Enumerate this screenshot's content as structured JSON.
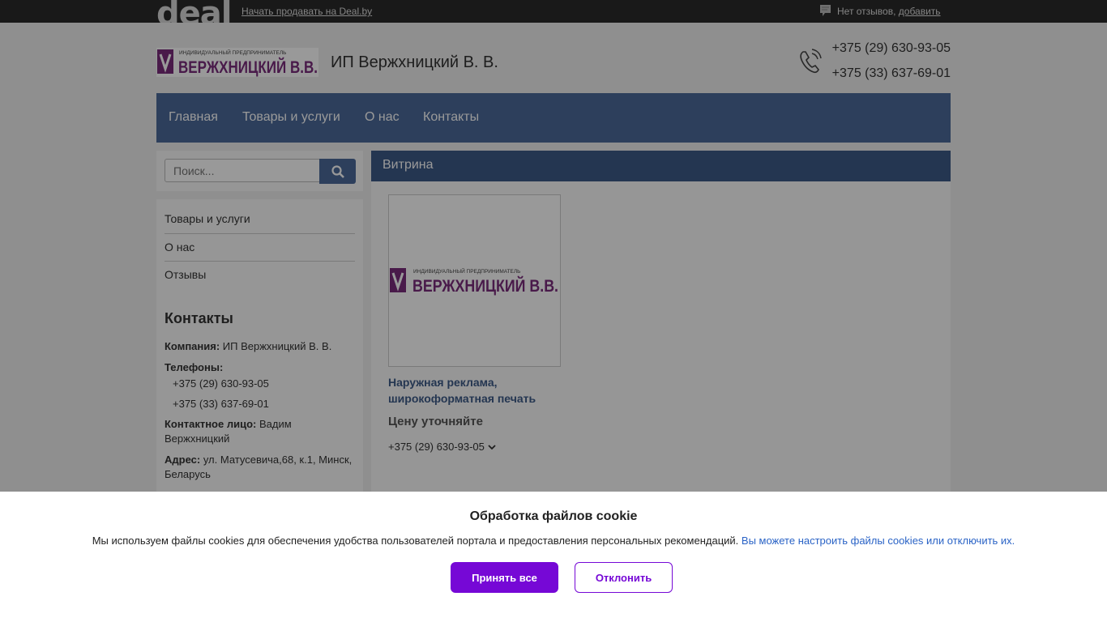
{
  "topbar": {
    "logo": "deal",
    "sell_link": "Начать продавать на Deal.by",
    "reviews_text": "Нет отзывов, ",
    "reviews_add": "добавить"
  },
  "header": {
    "logo_small_text": "ИНДИВИДУАЛЬНЫЙ ПРЕДПРИНИМАТЕЛЬ",
    "logo_big_text": "ВЕРЖХНИЦКИЙ В.В.",
    "company_name": "ИП Вержхницкий В. В.",
    "phones": [
      "+375 (29) 630-93-05",
      "+375 (33) 637-69-01"
    ]
  },
  "nav": {
    "items": [
      {
        "label": "Главная"
      },
      {
        "label": "Товары и услуги"
      },
      {
        "label": "О нас"
      },
      {
        "label": "Контакты"
      }
    ]
  },
  "search": {
    "placeholder": "Поиск..."
  },
  "sidebar": {
    "menu": [
      {
        "label": "Товары и услуги"
      },
      {
        "label": "О нас"
      },
      {
        "label": "Отзывы"
      }
    ],
    "contacts_title": "Контакты",
    "company_label": "Компания:",
    "company_value": "ИП Вержхницкий В. В.",
    "phones_label": "Телефоны:",
    "phones": [
      "+375 (29) 630-93-05",
      "+375 (33) 637-69-01"
    ],
    "person_label": "Контактное лицо:",
    "person_value": "Вадим Вержхницкий",
    "address_label": "Адрес:",
    "address_value": "ул. Матусевича,68, к.1, Минск, Беларусь"
  },
  "main": {
    "title": "Витрина",
    "product": {
      "title": "Наружная реклама, широкоформатная печать",
      "price": "Цену уточняйте",
      "phone": "+375 (29) 630-93-05"
    }
  },
  "cookie": {
    "title": "Обработка файлов cookie",
    "text": "Мы используем файлы cookies для обеспечения удобства пользователей портала и предоставления персональных рекомендаций.",
    "link": "Вы можете настроить файлы cookies или отключить их.",
    "accept": "Принять все",
    "decline": "Отклонить"
  },
  "colors": {
    "topbar": "#2b2b2b",
    "nav": "#4c6a9a",
    "main_header": "#3d5a88",
    "accent_purple": "#7608d6",
    "logo_purple": "#7a2c7c"
  }
}
